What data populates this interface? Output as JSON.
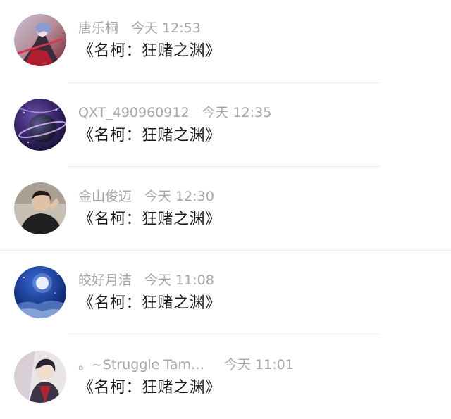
{
  "comments": [
    {
      "username": "唐乐桐",
      "time": "今天 12:53",
      "text": "《名柯：狂赌之渊》",
      "avatar_icon": "anime-warrior-avatar"
    },
    {
      "username": "QXT_490960912",
      "time": "今天 12:35",
      "text": "《名柯：狂赌之渊》",
      "avatar_icon": "planet-avatar"
    },
    {
      "username": "金山俊迈",
      "time": "今天 12:30",
      "text": "《名柯：狂赌之渊》",
      "avatar_icon": "man-portrait-avatar"
    },
    {
      "username": "皎好月洁",
      "time": "今天 11:08",
      "text": "《名柯：狂赌之渊》",
      "avatar_icon": "moon-night-avatar"
    },
    {
      "username": "。~Struggle Tam…",
      "time": "今天 11:01",
      "text": "《名柯：狂赌之渊》",
      "avatar_icon": "anime-character-avatar"
    }
  ],
  "colors": {
    "meta_text": "#a6a6a6",
    "body_text": "#1a1a1a",
    "divider": "#efefef",
    "background": "#ffffff"
  }
}
